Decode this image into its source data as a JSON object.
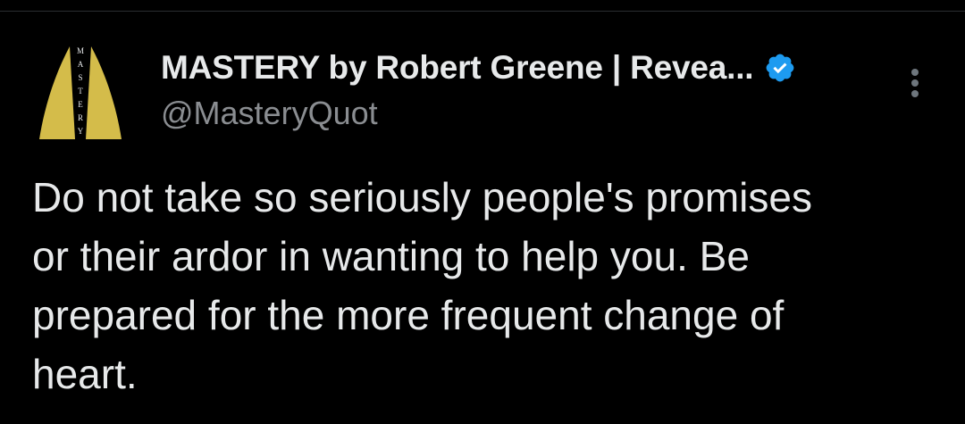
{
  "tweet": {
    "author": {
      "display_name": "MASTERY by Robert Greene | Revea...",
      "handle": "@MasteryQuot",
      "verified": true,
      "avatar_logo_text": "MASTERY"
    },
    "text": "Do not take so seriously people's promises\nor their ardor in wanting to help you. Be\nprepared for the more frequent change of\nheart."
  },
  "icons": {
    "verified": "verified-badge-icon",
    "more": "more-options-icon"
  },
  "colors": {
    "background": "#000000",
    "text_primary": "#e7e9ea",
    "text_secondary": "#8a8d91",
    "verified_blue": "#1d9bf0",
    "logo_gold": "#d4bc4a"
  }
}
